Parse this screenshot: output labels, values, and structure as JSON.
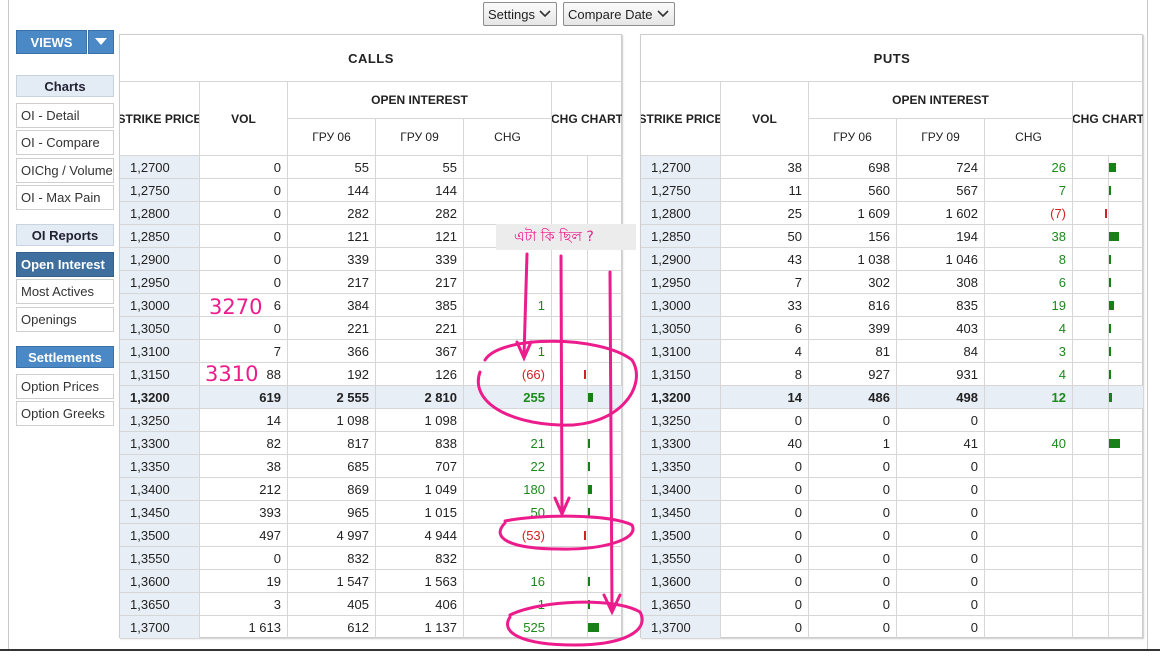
{
  "toolbar": {
    "settings_label": "Settings",
    "compare_date_label": "Compare Date"
  },
  "sidebar": {
    "views_label": "VIEWS",
    "charts_header": "Charts",
    "charts_items": [
      "OI - Detail",
      "OI - Compare",
      "OIChg / Volume",
      "OI - Max Pain"
    ],
    "oi_reports_header": "OI Reports",
    "oi_reports_items": [
      "Open Interest",
      "Most Actives",
      "Openings"
    ],
    "settlements_header": "Settlements",
    "settlements_items": [
      "Option Prices",
      "Option Greeks"
    ]
  },
  "calls": {
    "title": "CALLS",
    "columns": {
      "strike": "STRIKE PRICE",
      "vol": "VOL",
      "oi": "OPEN INTEREST",
      "m1": "ГРУ 06",
      "m2": "ГРУ 09",
      "chg": "CHG",
      "chart": "CHG CHART"
    },
    "rows": [
      {
        "strike": "1,2700",
        "vol": "0",
        "m1": "55",
        "m2": "55",
        "chg": "",
        "bar": 0
      },
      {
        "strike": "1,2750",
        "vol": "0",
        "m1": "144",
        "m2": "144",
        "chg": "",
        "bar": 0
      },
      {
        "strike": "1,2800",
        "vol": "0",
        "m1": "282",
        "m2": "282",
        "chg": "",
        "bar": 0
      },
      {
        "strike": "1,2850",
        "vol": "0",
        "m1": "121",
        "m2": "121",
        "chg": "",
        "bar": 0
      },
      {
        "strike": "1,2900",
        "vol": "0",
        "m1": "339",
        "m2": "339",
        "chg": "",
        "bar": 0
      },
      {
        "strike": "1,2950",
        "vol": "0",
        "m1": "217",
        "m2": "217",
        "chg": "",
        "bar": 0
      },
      {
        "strike": "1,3000",
        "vol": "6",
        "m1": "384",
        "m2": "385",
        "chg": "1",
        "bar": 0
      },
      {
        "strike": "1,3050",
        "vol": "0",
        "m1": "221",
        "m2": "221",
        "chg": "",
        "bar": 0
      },
      {
        "strike": "1,3100",
        "vol": "7",
        "m1": "366",
        "m2": "367",
        "chg": "1",
        "bar": 0
      },
      {
        "strike": "1,3150",
        "vol": "88",
        "m1": "192",
        "m2": "126",
        "chg": "(66)",
        "bar": -66
      },
      {
        "strike": "1,3200",
        "vol": "619",
        "m1": "2 555",
        "m2": "2 810",
        "chg": "255",
        "bar": 255
      },
      {
        "strike": "1,3250",
        "vol": "14",
        "m1": "1 098",
        "m2": "1 098",
        "chg": "",
        "bar": 0
      },
      {
        "strike": "1,3300",
        "vol": "82",
        "m1": "817",
        "m2": "838",
        "chg": "21",
        "bar": 21
      },
      {
        "strike": "1,3350",
        "vol": "38",
        "m1": "685",
        "m2": "707",
        "chg": "22",
        "bar": 22
      },
      {
        "strike": "1,3400",
        "vol": "212",
        "m1": "869",
        "m2": "1 049",
        "chg": "180",
        "bar": 180
      },
      {
        "strike": "1,3450",
        "vol": "393",
        "m1": "965",
        "m2": "1 015",
        "chg": "50",
        "bar": 50
      },
      {
        "strike": "1,3500",
        "vol": "497",
        "m1": "4 997",
        "m2": "4 944",
        "chg": "(53)",
        "bar": -53
      },
      {
        "strike": "1,3550",
        "vol": "0",
        "m1": "832",
        "m2": "832",
        "chg": "",
        "bar": 0
      },
      {
        "strike": "1,3600",
        "vol": "19",
        "m1": "1 547",
        "m2": "1 563",
        "chg": "16",
        "bar": 16
      },
      {
        "strike": "1,3650",
        "vol": "3",
        "m1": "405",
        "m2": "406",
        "chg": "1",
        "bar": 1
      },
      {
        "strike": "1,3700",
        "vol": "1 613",
        "m1": "612",
        "m2": "1 137",
        "chg": "525",
        "bar": 525
      }
    ]
  },
  "puts": {
    "title": "PUTS",
    "columns": {
      "strike": "STRIKE PRICE",
      "vol": "VOL",
      "oi": "OPEN INTEREST",
      "m1": "ГРУ 06",
      "m2": "ГРУ 09",
      "chg": "CHG",
      "chart": "CHG CHART"
    },
    "rows": [
      {
        "strike": "1,2700",
        "vol": "38",
        "m1": "698",
        "m2": "724",
        "chg": "26",
        "bar": 26
      },
      {
        "strike": "1,2750",
        "vol": "11",
        "m1": "560",
        "m2": "567",
        "chg": "7",
        "bar": 7
      },
      {
        "strike": "1,2800",
        "vol": "25",
        "m1": "1 609",
        "m2": "1 602",
        "chg": "(7)",
        "bar": -7
      },
      {
        "strike": "1,2850",
        "vol": "50",
        "m1": "156",
        "m2": "194",
        "chg": "38",
        "bar": 38
      },
      {
        "strike": "1,2900",
        "vol": "43",
        "m1": "1 038",
        "m2": "1 046",
        "chg": "8",
        "bar": 8
      },
      {
        "strike": "1,2950",
        "vol": "7",
        "m1": "302",
        "m2": "308",
        "chg": "6",
        "bar": 6
      },
      {
        "strike": "1,3000",
        "vol": "33",
        "m1": "816",
        "m2": "835",
        "chg": "19",
        "bar": 19
      },
      {
        "strike": "1,3050",
        "vol": "6",
        "m1": "399",
        "m2": "403",
        "chg": "4",
        "bar": 4
      },
      {
        "strike": "1,3100",
        "vol": "4",
        "m1": "81",
        "m2": "84",
        "chg": "3",
        "bar": 3
      },
      {
        "strike": "1,3150",
        "vol": "8",
        "m1": "927",
        "m2": "931",
        "chg": "4",
        "bar": 4
      },
      {
        "strike": "1,3200",
        "vol": "14",
        "m1": "486",
        "m2": "498",
        "chg": "12",
        "bar": 12
      },
      {
        "strike": "1,3250",
        "vol": "0",
        "m1": "0",
        "m2": "0",
        "chg": "",
        "bar": 0
      },
      {
        "strike": "1,3300",
        "vol": "40",
        "m1": "1",
        "m2": "41",
        "chg": "40",
        "bar": 40
      },
      {
        "strike": "1,3350",
        "vol": "0",
        "m1": "0",
        "m2": "0",
        "chg": "",
        "bar": 0
      },
      {
        "strike": "1,3400",
        "vol": "0",
        "m1": "0",
        "m2": "0",
        "chg": "",
        "bar": 0
      },
      {
        "strike": "1,3450",
        "vol": "0",
        "m1": "0",
        "m2": "0",
        "chg": "",
        "bar": 0
      },
      {
        "strike": "1,3500",
        "vol": "0",
        "m1": "0",
        "m2": "0",
        "chg": "",
        "bar": 0
      },
      {
        "strike": "1,3550",
        "vol": "0",
        "m1": "0",
        "m2": "0",
        "chg": "",
        "bar": 0
      },
      {
        "strike": "1,3600",
        "vol": "0",
        "m1": "0",
        "m2": "0",
        "chg": "",
        "bar": 0
      },
      {
        "strike": "1,3650",
        "vol": "0",
        "m1": "0",
        "m2": "0",
        "chg": "",
        "bar": 0
      },
      {
        "strike": "1,3700",
        "vol": "0",
        "m1": "0",
        "m2": "0",
        "chg": "",
        "bar": 0
      }
    ]
  },
  "highlight_strike": "1,3200",
  "colors": {
    "positive": "#1b8a1b",
    "negative": "#d42020",
    "annotation": "#ec1c8c",
    "strike_bg": "#e8eef5",
    "sidebar_blue": "#4a89c5"
  },
  "annotations": {
    "question": "এটা কি ছিল ?",
    "note1": "3270",
    "note2": "3310"
  }
}
